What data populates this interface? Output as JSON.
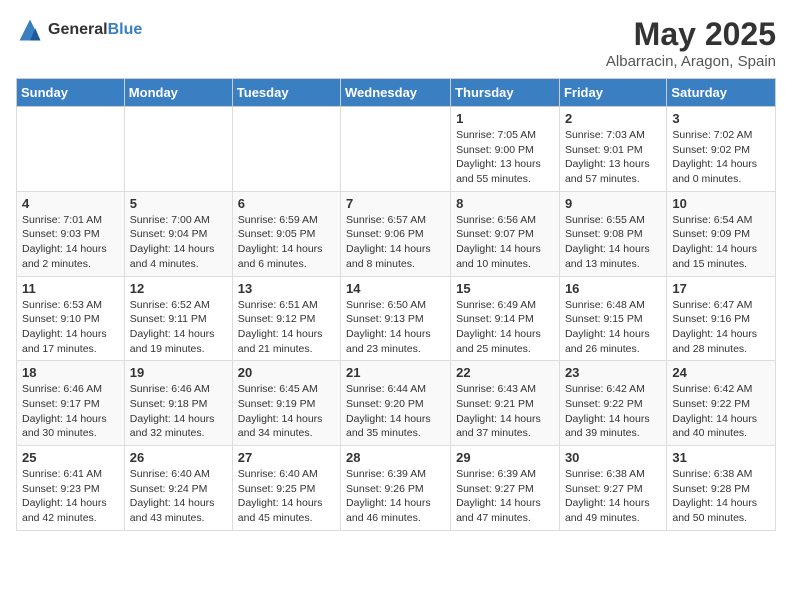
{
  "logo": {
    "general": "General",
    "blue": "Blue"
  },
  "title": "May 2025",
  "subtitle": "Albarracin, Aragon, Spain",
  "days_of_week": [
    "Sunday",
    "Monday",
    "Tuesday",
    "Wednesday",
    "Thursday",
    "Friday",
    "Saturday"
  ],
  "weeks": [
    [
      {
        "day": "",
        "sunrise": "",
        "sunset": "",
        "daylight": ""
      },
      {
        "day": "",
        "sunrise": "",
        "sunset": "",
        "daylight": ""
      },
      {
        "day": "",
        "sunrise": "",
        "sunset": "",
        "daylight": ""
      },
      {
        "day": "",
        "sunrise": "",
        "sunset": "",
        "daylight": ""
      },
      {
        "day": "1",
        "sunrise": "Sunrise: 7:05 AM",
        "sunset": "Sunset: 9:00 PM",
        "daylight": "Daylight: 13 hours and 55 minutes."
      },
      {
        "day": "2",
        "sunrise": "Sunrise: 7:03 AM",
        "sunset": "Sunset: 9:01 PM",
        "daylight": "Daylight: 13 hours and 57 minutes."
      },
      {
        "day": "3",
        "sunrise": "Sunrise: 7:02 AM",
        "sunset": "Sunset: 9:02 PM",
        "daylight": "Daylight: 14 hours and 0 minutes."
      }
    ],
    [
      {
        "day": "4",
        "sunrise": "Sunrise: 7:01 AM",
        "sunset": "Sunset: 9:03 PM",
        "daylight": "Daylight: 14 hours and 2 minutes."
      },
      {
        "day": "5",
        "sunrise": "Sunrise: 7:00 AM",
        "sunset": "Sunset: 9:04 PM",
        "daylight": "Daylight: 14 hours and 4 minutes."
      },
      {
        "day": "6",
        "sunrise": "Sunrise: 6:59 AM",
        "sunset": "Sunset: 9:05 PM",
        "daylight": "Daylight: 14 hours and 6 minutes."
      },
      {
        "day": "7",
        "sunrise": "Sunrise: 6:57 AM",
        "sunset": "Sunset: 9:06 PM",
        "daylight": "Daylight: 14 hours and 8 minutes."
      },
      {
        "day": "8",
        "sunrise": "Sunrise: 6:56 AM",
        "sunset": "Sunset: 9:07 PM",
        "daylight": "Daylight: 14 hours and 10 minutes."
      },
      {
        "day": "9",
        "sunrise": "Sunrise: 6:55 AM",
        "sunset": "Sunset: 9:08 PM",
        "daylight": "Daylight: 14 hours and 13 minutes."
      },
      {
        "day": "10",
        "sunrise": "Sunrise: 6:54 AM",
        "sunset": "Sunset: 9:09 PM",
        "daylight": "Daylight: 14 hours and 15 minutes."
      }
    ],
    [
      {
        "day": "11",
        "sunrise": "Sunrise: 6:53 AM",
        "sunset": "Sunset: 9:10 PM",
        "daylight": "Daylight: 14 hours and 17 minutes."
      },
      {
        "day": "12",
        "sunrise": "Sunrise: 6:52 AM",
        "sunset": "Sunset: 9:11 PM",
        "daylight": "Daylight: 14 hours and 19 minutes."
      },
      {
        "day": "13",
        "sunrise": "Sunrise: 6:51 AM",
        "sunset": "Sunset: 9:12 PM",
        "daylight": "Daylight: 14 hours and 21 minutes."
      },
      {
        "day": "14",
        "sunrise": "Sunrise: 6:50 AM",
        "sunset": "Sunset: 9:13 PM",
        "daylight": "Daylight: 14 hours and 23 minutes."
      },
      {
        "day": "15",
        "sunrise": "Sunrise: 6:49 AM",
        "sunset": "Sunset: 9:14 PM",
        "daylight": "Daylight: 14 hours and 25 minutes."
      },
      {
        "day": "16",
        "sunrise": "Sunrise: 6:48 AM",
        "sunset": "Sunset: 9:15 PM",
        "daylight": "Daylight: 14 hours and 26 minutes."
      },
      {
        "day": "17",
        "sunrise": "Sunrise: 6:47 AM",
        "sunset": "Sunset: 9:16 PM",
        "daylight": "Daylight: 14 hours and 28 minutes."
      }
    ],
    [
      {
        "day": "18",
        "sunrise": "Sunrise: 6:46 AM",
        "sunset": "Sunset: 9:17 PM",
        "daylight": "Daylight: 14 hours and 30 minutes."
      },
      {
        "day": "19",
        "sunrise": "Sunrise: 6:46 AM",
        "sunset": "Sunset: 9:18 PM",
        "daylight": "Daylight: 14 hours and 32 minutes."
      },
      {
        "day": "20",
        "sunrise": "Sunrise: 6:45 AM",
        "sunset": "Sunset: 9:19 PM",
        "daylight": "Daylight: 14 hours and 34 minutes."
      },
      {
        "day": "21",
        "sunrise": "Sunrise: 6:44 AM",
        "sunset": "Sunset: 9:20 PM",
        "daylight": "Daylight: 14 hours and 35 minutes."
      },
      {
        "day": "22",
        "sunrise": "Sunrise: 6:43 AM",
        "sunset": "Sunset: 9:21 PM",
        "daylight": "Daylight: 14 hours and 37 minutes."
      },
      {
        "day": "23",
        "sunrise": "Sunrise: 6:42 AM",
        "sunset": "Sunset: 9:22 PM",
        "daylight": "Daylight: 14 hours and 39 minutes."
      },
      {
        "day": "24",
        "sunrise": "Sunrise: 6:42 AM",
        "sunset": "Sunset: 9:22 PM",
        "daylight": "Daylight: 14 hours and 40 minutes."
      }
    ],
    [
      {
        "day": "25",
        "sunrise": "Sunrise: 6:41 AM",
        "sunset": "Sunset: 9:23 PM",
        "daylight": "Daylight: 14 hours and 42 minutes."
      },
      {
        "day": "26",
        "sunrise": "Sunrise: 6:40 AM",
        "sunset": "Sunset: 9:24 PM",
        "daylight": "Daylight: 14 hours and 43 minutes."
      },
      {
        "day": "27",
        "sunrise": "Sunrise: 6:40 AM",
        "sunset": "Sunset: 9:25 PM",
        "daylight": "Daylight: 14 hours and 45 minutes."
      },
      {
        "day": "28",
        "sunrise": "Sunrise: 6:39 AM",
        "sunset": "Sunset: 9:26 PM",
        "daylight": "Daylight: 14 hours and 46 minutes."
      },
      {
        "day": "29",
        "sunrise": "Sunrise: 6:39 AM",
        "sunset": "Sunset: 9:27 PM",
        "daylight": "Daylight: 14 hours and 47 minutes."
      },
      {
        "day": "30",
        "sunrise": "Sunrise: 6:38 AM",
        "sunset": "Sunset: 9:27 PM",
        "daylight": "Daylight: 14 hours and 49 minutes."
      },
      {
        "day": "31",
        "sunrise": "Sunrise: 6:38 AM",
        "sunset": "Sunset: 9:28 PM",
        "daylight": "Daylight: 14 hours and 50 minutes."
      }
    ]
  ]
}
